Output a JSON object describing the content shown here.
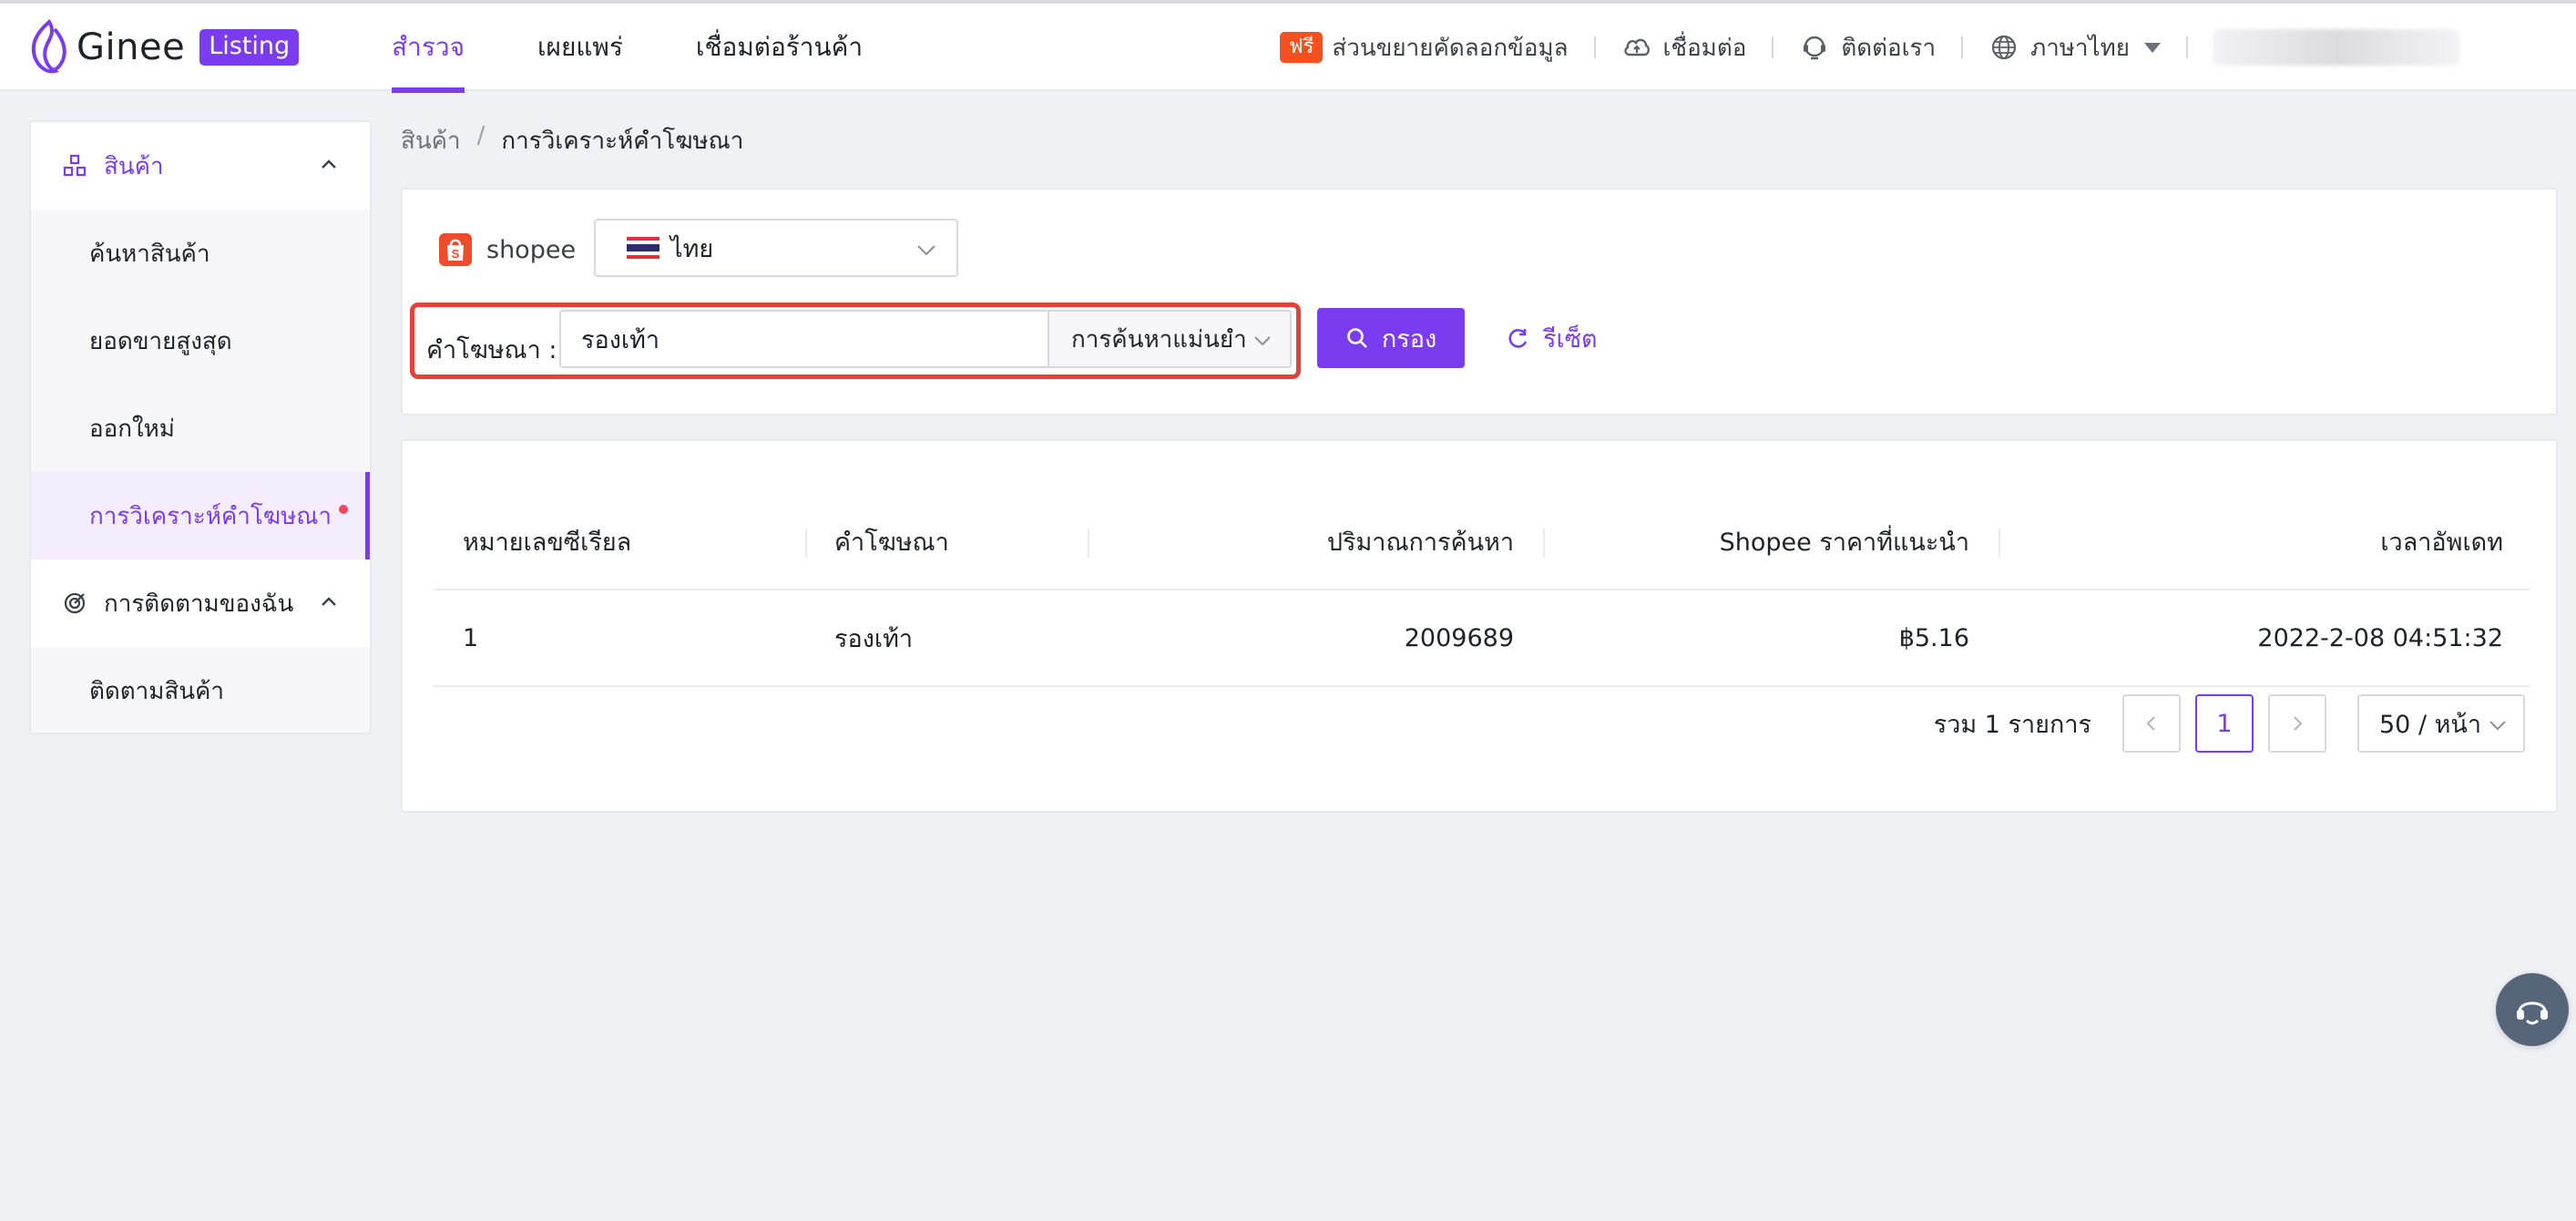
{
  "brand": {
    "name": "Ginee",
    "badge": "Listing"
  },
  "nav": {
    "items": [
      "สำรวจ",
      "เผยแพร่",
      "เชื่อมต่อร้านค้า"
    ],
    "active_index": 0
  },
  "header_right": {
    "free_badge": "ฟรี",
    "free_text": "ส่วนขยายคัดลอกข้อมูล",
    "connect": "เชื่อมต่อ",
    "contact": "ติดต่อเรา",
    "language": "ภาษาไทย"
  },
  "sidebar": {
    "group1": {
      "label": "สินค้า",
      "icon": "product-icon"
    },
    "items": [
      "ค้นหาสินค้า",
      "ยอดขายสูงสุด",
      "ออกใหม่",
      "การวิเคราะห์คำโฆษณา"
    ],
    "active_item_index": 3,
    "group2": {
      "label": "การติดตามของฉัน",
      "icon": "target-icon"
    },
    "group2_items": [
      "ติดตามสินค้า"
    ]
  },
  "breadcrumb": {
    "root": "สินค้า",
    "separator": "/",
    "current": "การวิเคราะห์คำโฆษณา"
  },
  "filter": {
    "platform": "shopee",
    "country": "ไทย",
    "keyword_label": "คำโฆษณา :",
    "keyword_value": "รองเท้า",
    "match_type": "การค้นหาแม่นยำ",
    "search_button": "กรอง",
    "reset_button": "รีเซ็ต"
  },
  "table": {
    "columns": [
      "หมายเลขซีเรียล",
      "คำโฆษณา",
      "ปริมาณการค้นหา",
      "Shopee ราคาที่แนะนำ",
      "เวลาอัพเดท"
    ],
    "rows": [
      {
        "serial": "1",
        "keyword": "รองเท้า",
        "volume": "2009689",
        "price": "฿5.16",
        "updated": "2022-2-08 04:51:32"
      }
    ]
  },
  "pagination": {
    "total": "รวม 1 รายการ",
    "current_page": "1",
    "page_size": "50 / หน้า"
  },
  "colors": {
    "accent": "#7b3cf0",
    "highlight": "#e5413b",
    "shopee": "#ee4d2d"
  }
}
